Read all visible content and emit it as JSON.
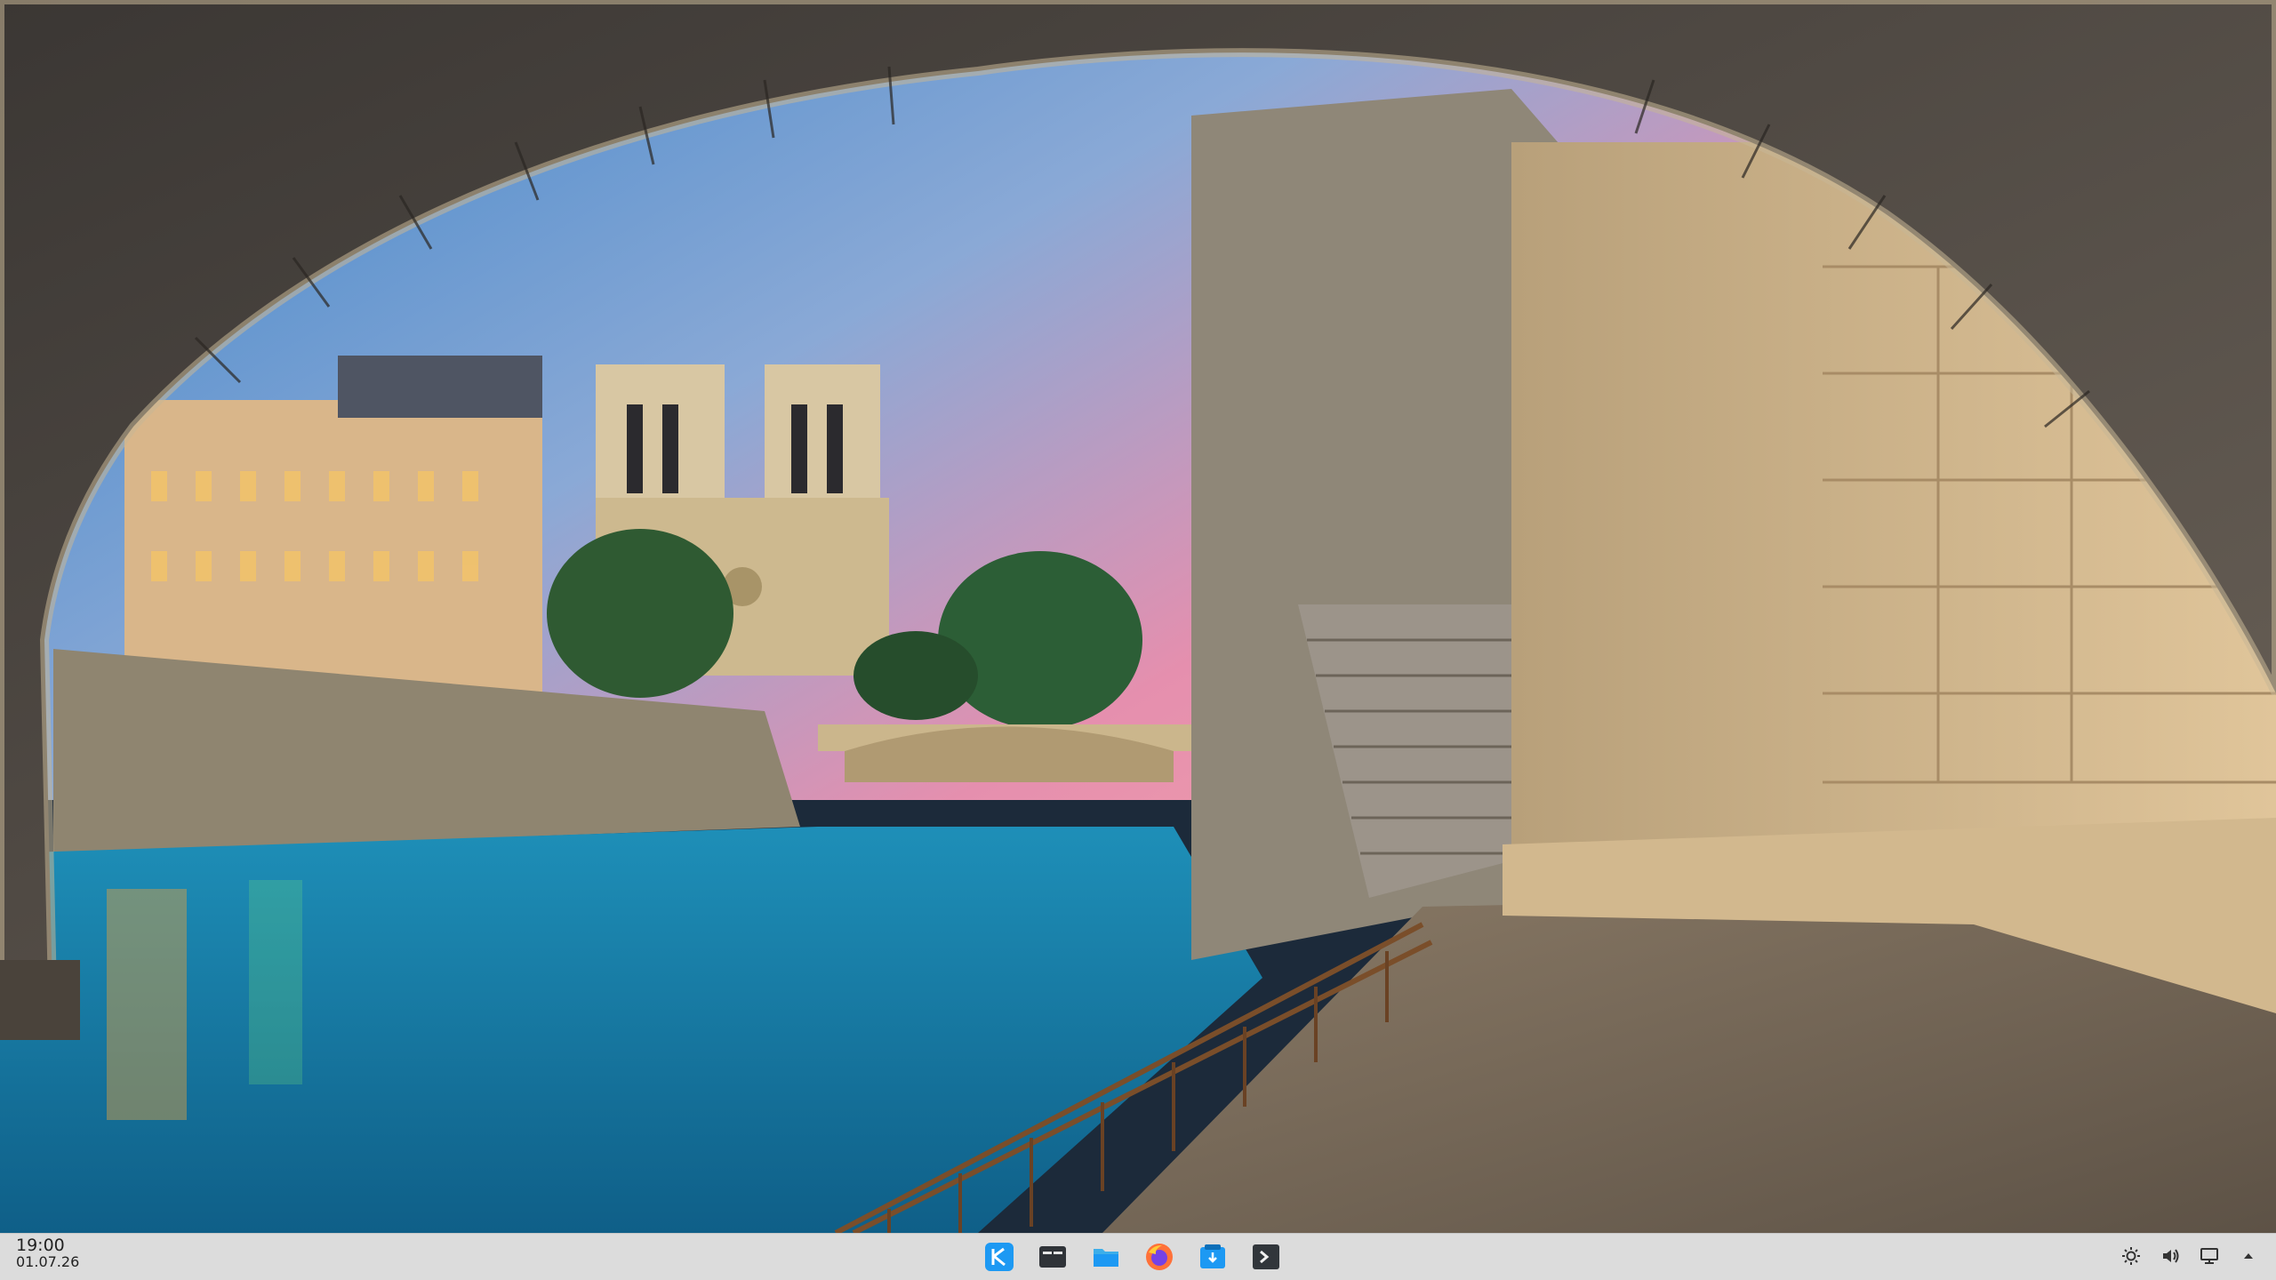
{
  "desktop": {
    "wallpaper": "paris-seine-notre-dame-under-bridge"
  },
  "taskbar": {
    "clock": {
      "time": "19:00",
      "date": "01.07.26"
    },
    "apps": [
      {
        "name": "application-launcher",
        "icon": "kde-icon"
      },
      {
        "name": "task-manager",
        "icon": "window-switcher-icon"
      },
      {
        "name": "file-manager",
        "icon": "folder-icon"
      },
      {
        "name": "web-browser",
        "icon": "firefox-icon"
      },
      {
        "name": "software-store",
        "icon": "store-icon"
      },
      {
        "name": "terminal",
        "icon": "terminal-icon"
      }
    ],
    "tray": [
      {
        "name": "brightness",
        "icon": "brightness-icon"
      },
      {
        "name": "volume",
        "icon": "volume-icon"
      },
      {
        "name": "display",
        "icon": "display-icon"
      },
      {
        "name": "expand-tray",
        "icon": "chevron-up-icon"
      }
    ],
    "colors": {
      "bar": "#dcdcdc",
      "accent": "#1d99f3"
    }
  }
}
